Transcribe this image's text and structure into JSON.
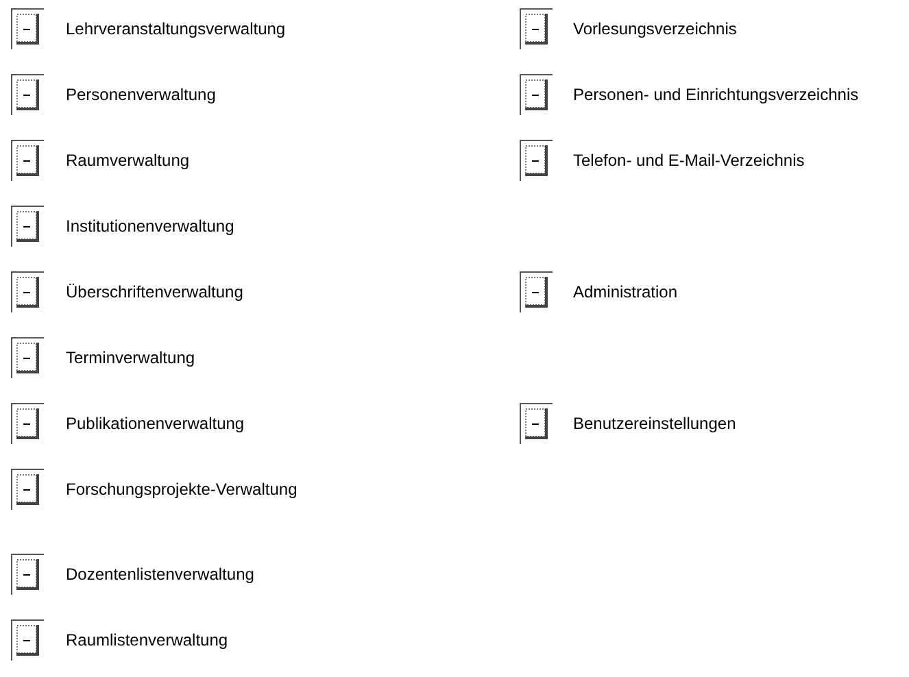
{
  "rows": [
    {
      "left": "Lehrveranstaltungsverwaltung",
      "right": "Vorlesungsverzeichnis"
    },
    {
      "left": "Personenverwaltung",
      "right": "Personen- und Einrichtungsverzeichnis"
    },
    {
      "left": "Raumverwaltung",
      "right": "Telefon- und E-Mail-Verzeichnis"
    },
    {
      "left": "Institutionenverwaltung"
    },
    {
      "left": "Überschriftenverwaltung",
      "right": "Administration"
    },
    {
      "left": "Terminverwaltung"
    },
    {
      "left": "Publikationenverwaltung",
      "right": "Benutzereinstellungen"
    },
    {
      "left": "Forschungsprojekte-Verwaltung"
    }
  ],
  "lower_rows": [
    {
      "left": "Dozentenlistenverwaltung"
    },
    {
      "left": "Raumlistenverwaltung"
    }
  ]
}
